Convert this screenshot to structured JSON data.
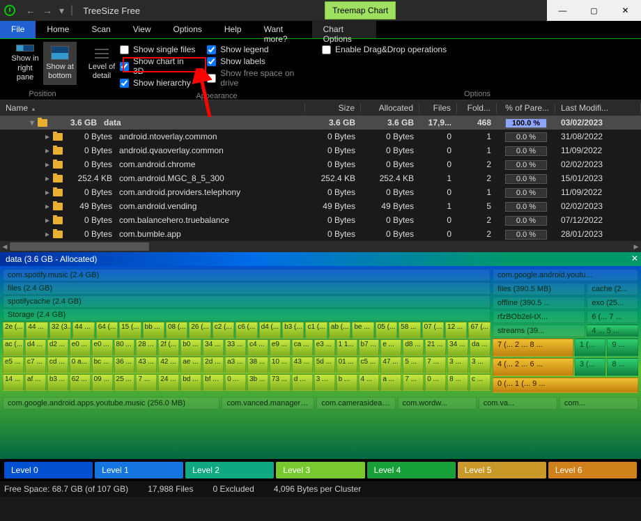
{
  "title": "TreeSize Free",
  "tab": "Treemap Chart",
  "menu": [
    "File",
    "Home",
    "Scan",
    "View",
    "Options",
    "Help",
    "Want more?",
    "Chart Options"
  ],
  "ribbon": {
    "pos_label": "Position",
    "right": "Show in right pane",
    "bottom": "Show at bottom",
    "lod": "Level of detail",
    "appearance": "Appearance",
    "options_label": "Options",
    "chk_single": "Show single files",
    "chk_3d": "Show chart in 3D",
    "chk_hier": "Show hierarchy",
    "chk_legend": "Show legend",
    "chk_labels": "Show labels",
    "chk_free": "Show free space on drive",
    "chk_drag": "Enable Drag&Drop operations"
  },
  "cols": {
    "name": "Name",
    "size": "Size",
    "alloc": "Allocated",
    "files": "Files",
    "fold": "Fold...",
    "pct": "% of Pare...",
    "mod": "Last Modifi..."
  },
  "rows": [
    {
      "indent": 40,
      "exp": "▾",
      "name": "data",
      "inline_size": "3.6 GB",
      "size": "3.6 GB",
      "alloc": "3.6 GB",
      "files": "17,9...",
      "fold": "468",
      "pct": "100.0 %",
      "mod": "03/02/2023",
      "sel": true,
      "full": true
    },
    {
      "indent": 62,
      "exp": "▸",
      "name": "android.ntoverlay.common",
      "inline_size": "0 Bytes",
      "size": "0 Bytes",
      "alloc": "0 Bytes",
      "files": "0",
      "fold": "1",
      "pct": "0.0 %",
      "mod": "31/08/2022"
    },
    {
      "indent": 62,
      "exp": "▸",
      "name": "android.qvaoverlay.common",
      "inline_size": "0 Bytes",
      "size": "0 Bytes",
      "alloc": "0 Bytes",
      "files": "0",
      "fold": "1",
      "pct": "0.0 %",
      "mod": "11/09/2022"
    },
    {
      "indent": 62,
      "exp": "▸",
      "name": "com.android.chrome",
      "inline_size": "0 Bytes",
      "size": "0 Bytes",
      "alloc": "0 Bytes",
      "files": "0",
      "fold": "2",
      "pct": "0.0 %",
      "mod": "02/02/2023"
    },
    {
      "indent": 62,
      "exp": "▸",
      "name": "com.android.MGC_8_5_300",
      "inline_size": "252.4 KB",
      "size": "252.4 KB",
      "alloc": "252.4 KB",
      "files": "1",
      "fold": "2",
      "pct": "0.0 %",
      "mod": "15/01/2023"
    },
    {
      "indent": 62,
      "exp": "▸",
      "name": "com.android.providers.telephony",
      "inline_size": "0 Bytes",
      "size": "0 Bytes",
      "alloc": "0 Bytes",
      "files": "0",
      "fold": "1",
      "pct": "0.0 %",
      "mod": "11/09/2022"
    },
    {
      "indent": 62,
      "exp": "▸",
      "name": "com.android.vending",
      "inline_size": "49 Bytes",
      "size": "49 Bytes",
      "alloc": "49 Bytes",
      "files": "1",
      "fold": "5",
      "pct": "0.0 %",
      "mod": "02/02/2023"
    },
    {
      "indent": 62,
      "exp": "▸",
      "name": "com.balancehero.truebalance",
      "inline_size": "0 Bytes",
      "size": "0 Bytes",
      "alloc": "0 Bytes",
      "files": "0",
      "fold": "2",
      "pct": "0.0 %",
      "mod": "07/12/2022"
    },
    {
      "indent": 62,
      "exp": "▸",
      "name": "com.bumble.app",
      "inline_size": "0 Bytes",
      "size": "0 Bytes",
      "alloc": "0 Bytes",
      "files": "0",
      "fold": "2",
      "pct": "0.0 %",
      "mod": "28/01/2023"
    }
  ],
  "treemap": {
    "title": "data (3.6 GB - Allocated)",
    "l1a": "com.spotify.music (2.4 GB)",
    "l1b": "com.google.android.youtu...",
    "l2a": "files (2.4 GB)",
    "l2b": "files (390.5 MB)",
    "l2c": "cache (2...",
    "l3a": "spotifycache (2.4 GB)",
    "l3b": "offline (390.5 ...",
    "l3c": "exo (25...",
    "l4a": "Storage (2.4 GB)",
    "l4b": "rfzBOb2el-tX...",
    "l4c": "6 (... 7 ...",
    "l5b": "streams (39...",
    "l5c": "4 ... 5 ...",
    "r5a": [
      "2e (...",
      "44 ...",
      "32 (3...",
      "44 ...",
      "64 (...",
      "15 (...",
      "bb ...",
      "08 (...",
      "26 (...",
      "c2 (...",
      "c6 (...",
      "d4 (...",
      "b3 (...",
      "c1 (...",
      "ab (...",
      "be ...",
      "05 (...",
      "58 ...",
      "07 (...",
      "12 ...",
      "67 (..."
    ],
    "r5b": [
      "ac (...",
      "d4 ...",
      "d2 ...",
      "e0 ...",
      "e0 ...",
      "80 ...",
      "28 ...",
      "2f (...",
      "b0 ...",
      "34 ...",
      "33 ...",
      "c4 ...",
      "e9 ...",
      "ca ...",
      "e3 ...",
      "1 1...",
      "b7 ...",
      "e ...",
      "d8 ...",
      "21 ...",
      "34 ...",
      "da ..."
    ],
    "r5c": [
      "e5 ...",
      "c7 ...",
      "cd ...",
      "0 a...",
      "bc ...",
      "36 ...",
      "43 ...",
      "42 ...",
      "ae ...",
      "2d ...",
      "a3 ...",
      "38 ...",
      "10 ...",
      "43 ...",
      "5d ...",
      "01 ...",
      "c5 ...",
      "47 ...",
      "5 ...",
      "7 ...",
      "3 ...",
      "3 ..."
    ],
    "r5d": [
      "14 ...",
      "af ...",
      "b3 ...",
      "62 ...",
      "09 ...",
      "25 ...",
      "7 ...",
      "24 ...",
      "bd ...",
      "bf ...",
      "0 ...",
      "3b ...",
      "73 ...",
      "d ...",
      "3 ...",
      "b ...",
      "4 ...",
      "a ...",
      "7 ...",
      "0 ...",
      "8 ...",
      "c ..."
    ],
    "r6a": "7 (...  2 ...  8 ...",
    "r6b": "1 (...",
    "r6c": "9 ...",
    "r6d": "4 (...  2 ...  6 ...",
    "r6e": "3 (...",
    "r6f": "8 ...",
    "r7a": "0 (...  1 (...  9 ...",
    "bot": [
      "com.google.android.apps.youtube.music (256.0 MB)",
      "com.vanced.manager (1...",
      "com.camerasideas.tri...",
      "com.wordw...",
      "com.va...",
      "com..."
    ]
  },
  "levels": [
    "Level 0",
    "Level 1",
    "Level 2",
    "Level 3",
    "Level 4",
    "Level 5",
    "Level 6"
  ],
  "level_colors": [
    "#0050d0",
    "#1575e0",
    "#10a880",
    "#78c830",
    "#18a038",
    "#c89828",
    "#d08018"
  ],
  "status": {
    "free": "Free Space: 68.7 GB  (of 107 GB)",
    "files": "17,988 Files",
    "excl": "0 Excluded",
    "cluster": "4,096 Bytes per Cluster"
  }
}
